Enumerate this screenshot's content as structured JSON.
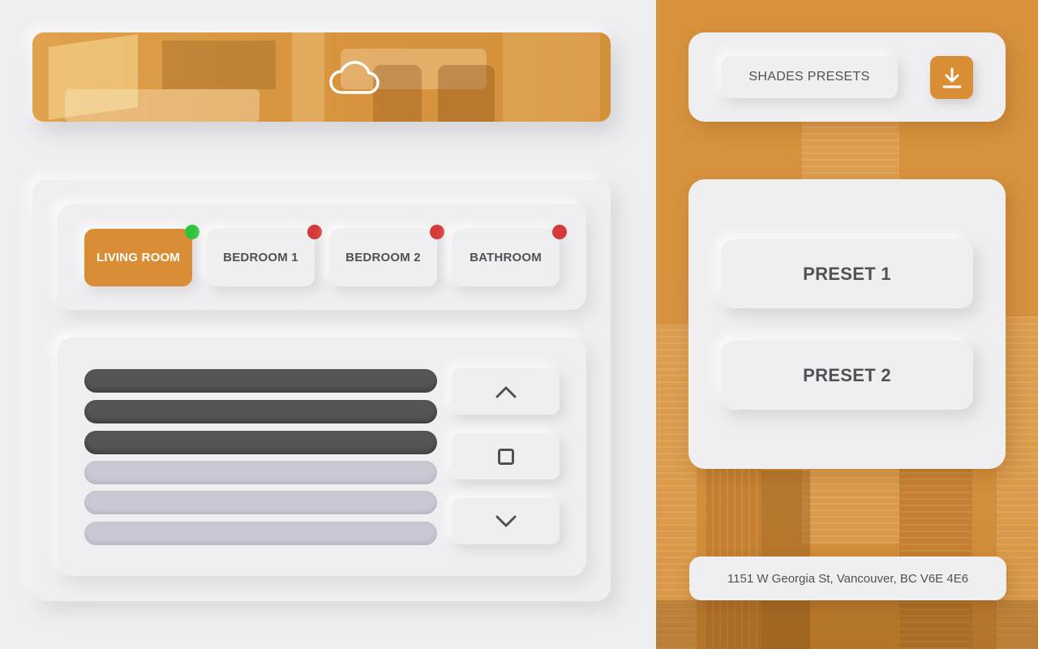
{
  "header": {
    "weather_icon": "cloud-icon"
  },
  "rooms": [
    {
      "label": "LIVING ROOM",
      "active": true,
      "status": "online"
    },
    {
      "label": "BEDROOM 1",
      "active": false,
      "status": "offline"
    },
    {
      "label": "BEDROOM 2",
      "active": false,
      "status": "offline"
    },
    {
      "label": "BATHROOM",
      "active": false,
      "status": "offline"
    }
  ],
  "shade": {
    "slats_closed": 3,
    "slats_total": 6,
    "controls": [
      "chevron-up-icon",
      "stop-icon",
      "chevron-down-icon"
    ]
  },
  "presets_panel": {
    "title": "SHADES PRESETS",
    "download_icon": "download-icon",
    "presets": [
      "PRESET 1",
      "PRESET 2"
    ]
  },
  "address": "1151 W Georgia St, Vancouver, BC V6E 4E6",
  "colors": {
    "accent": "#d98e36",
    "background": "#efeff1",
    "status_on": "#2fc43c",
    "status_off": "#d53a3a",
    "slat_dark": "#555558",
    "slat_light": "#c9c9d3",
    "text": "#4f5159"
  }
}
